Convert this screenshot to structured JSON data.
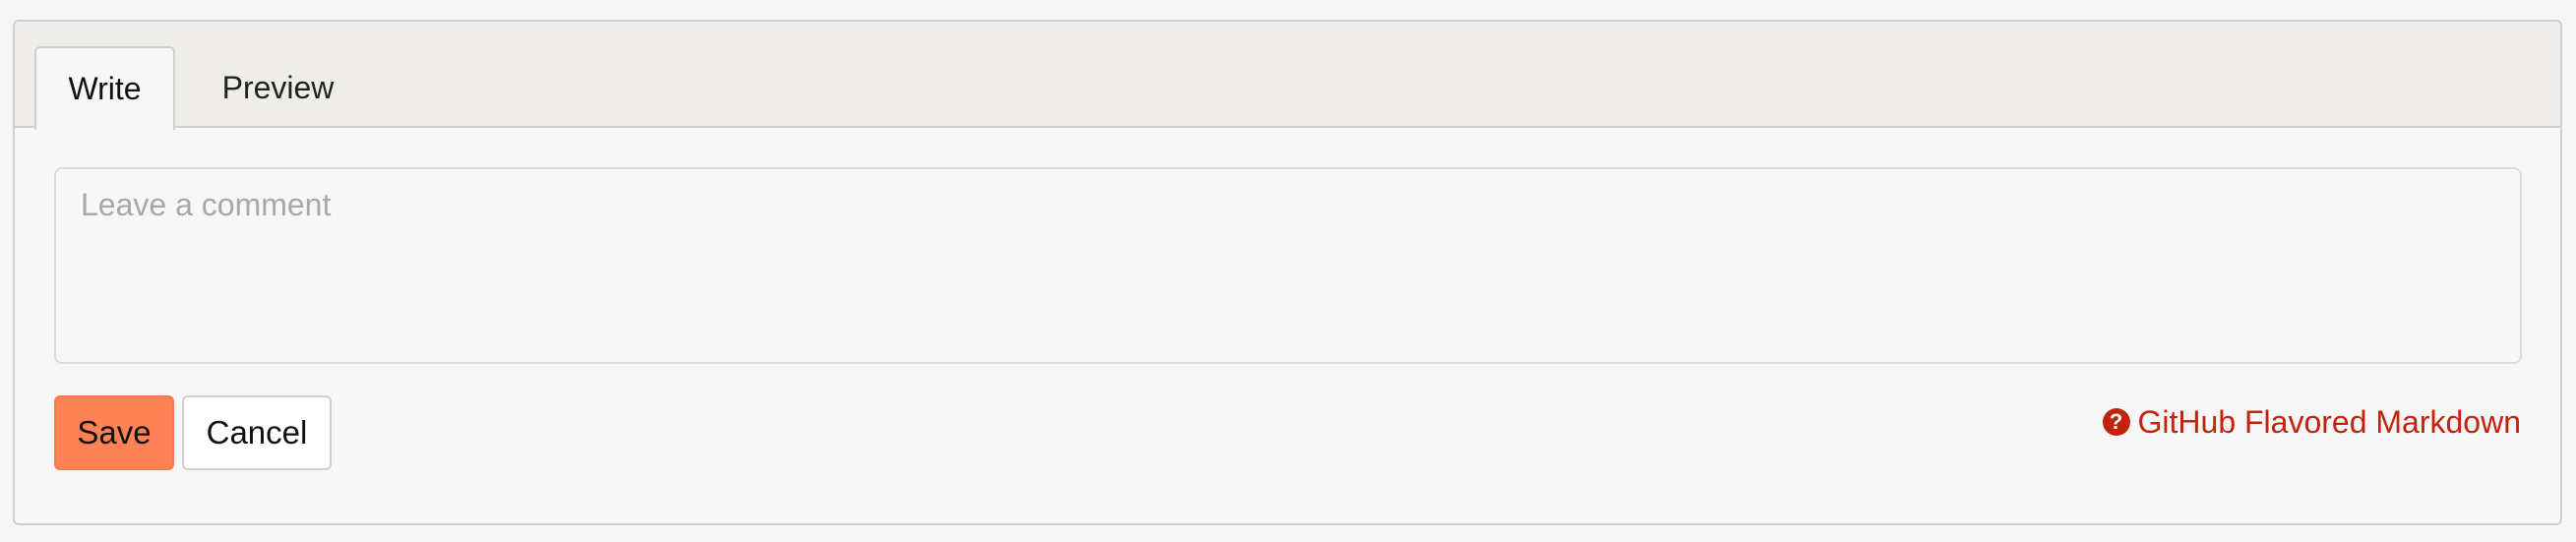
{
  "tabs": [
    {
      "label": "Write",
      "active": true
    },
    {
      "label": "Preview",
      "active": false
    }
  ],
  "comment": {
    "value": "",
    "placeholder": "Leave a comment"
  },
  "actions": {
    "save_label": "Save",
    "cancel_label": "Cancel"
  },
  "markdown_help": {
    "icon": "question-circle-icon",
    "label": "GitHub Flavored Markdown"
  },
  "colors": {
    "accent": "#ff8156",
    "link": "#c3220d",
    "tabbar_bg": "#eeede9"
  }
}
